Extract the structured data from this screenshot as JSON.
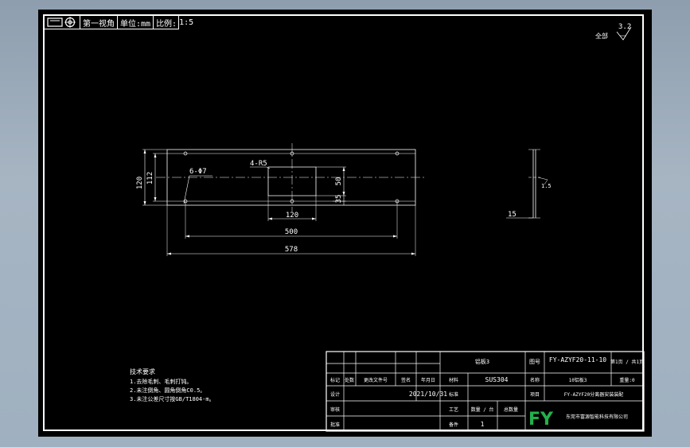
{
  "toolbar": {
    "view_label": "第一视角",
    "unit_label": "单位:mm",
    "scale_label": "比例:",
    "scale_value": "1:5"
  },
  "roughness": {
    "label": "全部",
    "value": "3.2"
  },
  "dimensions": {
    "hole_callout": "6-Φ7",
    "radius_callout": "4-R5",
    "height_outer": "120",
    "height_inner": "112",
    "cutout_height": "50",
    "cutout_offset": "35",
    "cutout_width": "120",
    "hole_span": "500",
    "overall_width": "578",
    "side_thickness": "1.5"
  },
  "notes": {
    "title": "技术要求",
    "lines": [
      "1.去除毛刺、毛刺打钝。",
      "2.未注倒角、圆角倒角C0.5。",
      "3.未注公差尺寸按GB/T1804-m。"
    ]
  },
  "title_block": {
    "part_label": "铝板3",
    "drawing_no_label": "图号",
    "drawing_no": "FY-AZYF20-11-10",
    "sheet_label": "第1页 / 共1页",
    "name_label": "名称",
    "name_value": "10铝板3",
    "weight_label": "重量:0",
    "material_label": "材料",
    "material": "SUS304",
    "project_label": "项目",
    "project_value": "FY-AZYF20分离器安装装配",
    "col_mark": "标记",
    "col_count": "处数",
    "col_change": "更改文件号",
    "col_sign": "签名",
    "col_date": "年月日",
    "designer_label": "设计",
    "date": "2021/10/31",
    "std_label": "标准",
    "review_label": "审核",
    "process_label": "工艺",
    "qty_label": "数量 / 台",
    "qty_value": "1",
    "total_label": "总数量",
    "approve_label": "批准",
    "spare_label": "备件",
    "logo": "FY",
    "company": "东莞市富源智能科技有限公司",
    "brand_color": "#22b14c"
  }
}
